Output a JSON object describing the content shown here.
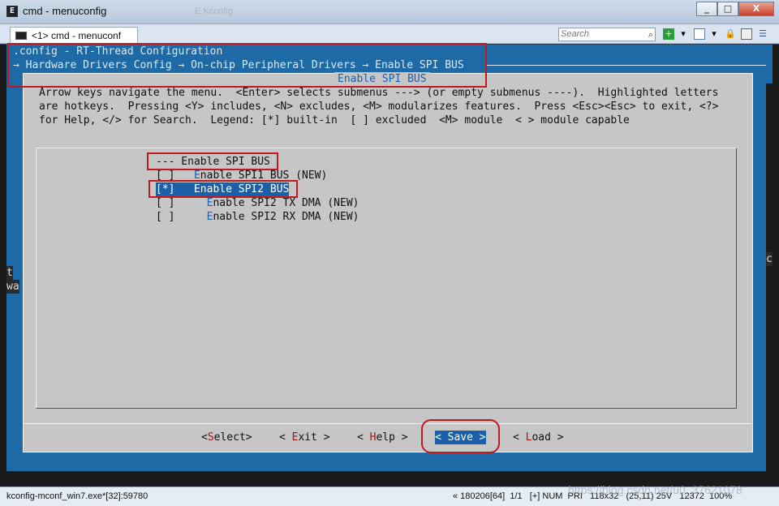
{
  "window": {
    "title": "cmd - menuconfig",
    "ghost_title": "E Kconfig",
    "min": "_",
    "max": "□",
    "close": "X"
  },
  "tab": {
    "label": "<1> cmd - menuconf"
  },
  "search": {
    "placeholder": "Search"
  },
  "toolbar_icons": [
    "add-icon",
    "chevron-down-icon",
    "panel-icon",
    "chevron-down-icon",
    "lock-icon",
    "layout-icon",
    "menu-icon"
  ],
  "terminal": {
    "header_title": ".config - RT-Thread Configuration",
    "breadcrumb": "→ Hardware Drivers Config → On-chip Peripheral Drivers → Enable SPI BUS",
    "dialog_title": "Enable SPI BUS",
    "help": [
      "Arrow keys navigate the menu.  <Enter> selects submenus ---> (or empty submenus ----).  Highlighted letters",
      "are hotkeys.  Pressing <Y> includes, <N> excludes, <M> modularizes features.  Press <Esc><Esc> to exit, <?>",
      "for Help, </> for Search.  Legend: [*] built-in  [ ] excluded  <M> module  < > module capable"
    ],
    "items": [
      {
        "text": "--- Enable SPI BUS"
      },
      {
        "box": "[ ]",
        "hot": "E",
        "rest": "nable SPI1 BUS (NEW)"
      },
      {
        "box": "[*]",
        "hot": "E",
        "rest": "nable SPI2 BUS",
        "selected": true
      },
      {
        "box": "[ ]",
        "hot": "E",
        "rest": "nable SPI2 TX DMA (NEW)"
      },
      {
        "box": "[ ]",
        "hot": "E",
        "rest": "nable SPI2 RX DMA (NEW)"
      }
    ],
    "buttons": [
      {
        "pre": "<",
        "hk": "S",
        "post": "elect>"
      },
      {
        "pre": "< ",
        "hk": "E",
        "post": "xit >"
      },
      {
        "pre": "< ",
        "hk": "H",
        "post": "elp >"
      },
      {
        "pre": "< ",
        "hk": "S",
        "post": "ave >",
        "active": true
      },
      {
        "pre": "< ",
        "hk": "L",
        "post": "oad >"
      }
    ],
    "left_fragments": [
      "t",
      "wa"
    ],
    "right_fragment": "c"
  },
  "status": {
    "left": "kconfig-mconf_win7.exe*[32]:59780",
    "right": "« 180206[64]  1/1   [+] NUM  PRI   118x32   (25,11) 25V   12372  100%"
  },
  "watermark": "https://blog.csdn.net/u0_37621078"
}
